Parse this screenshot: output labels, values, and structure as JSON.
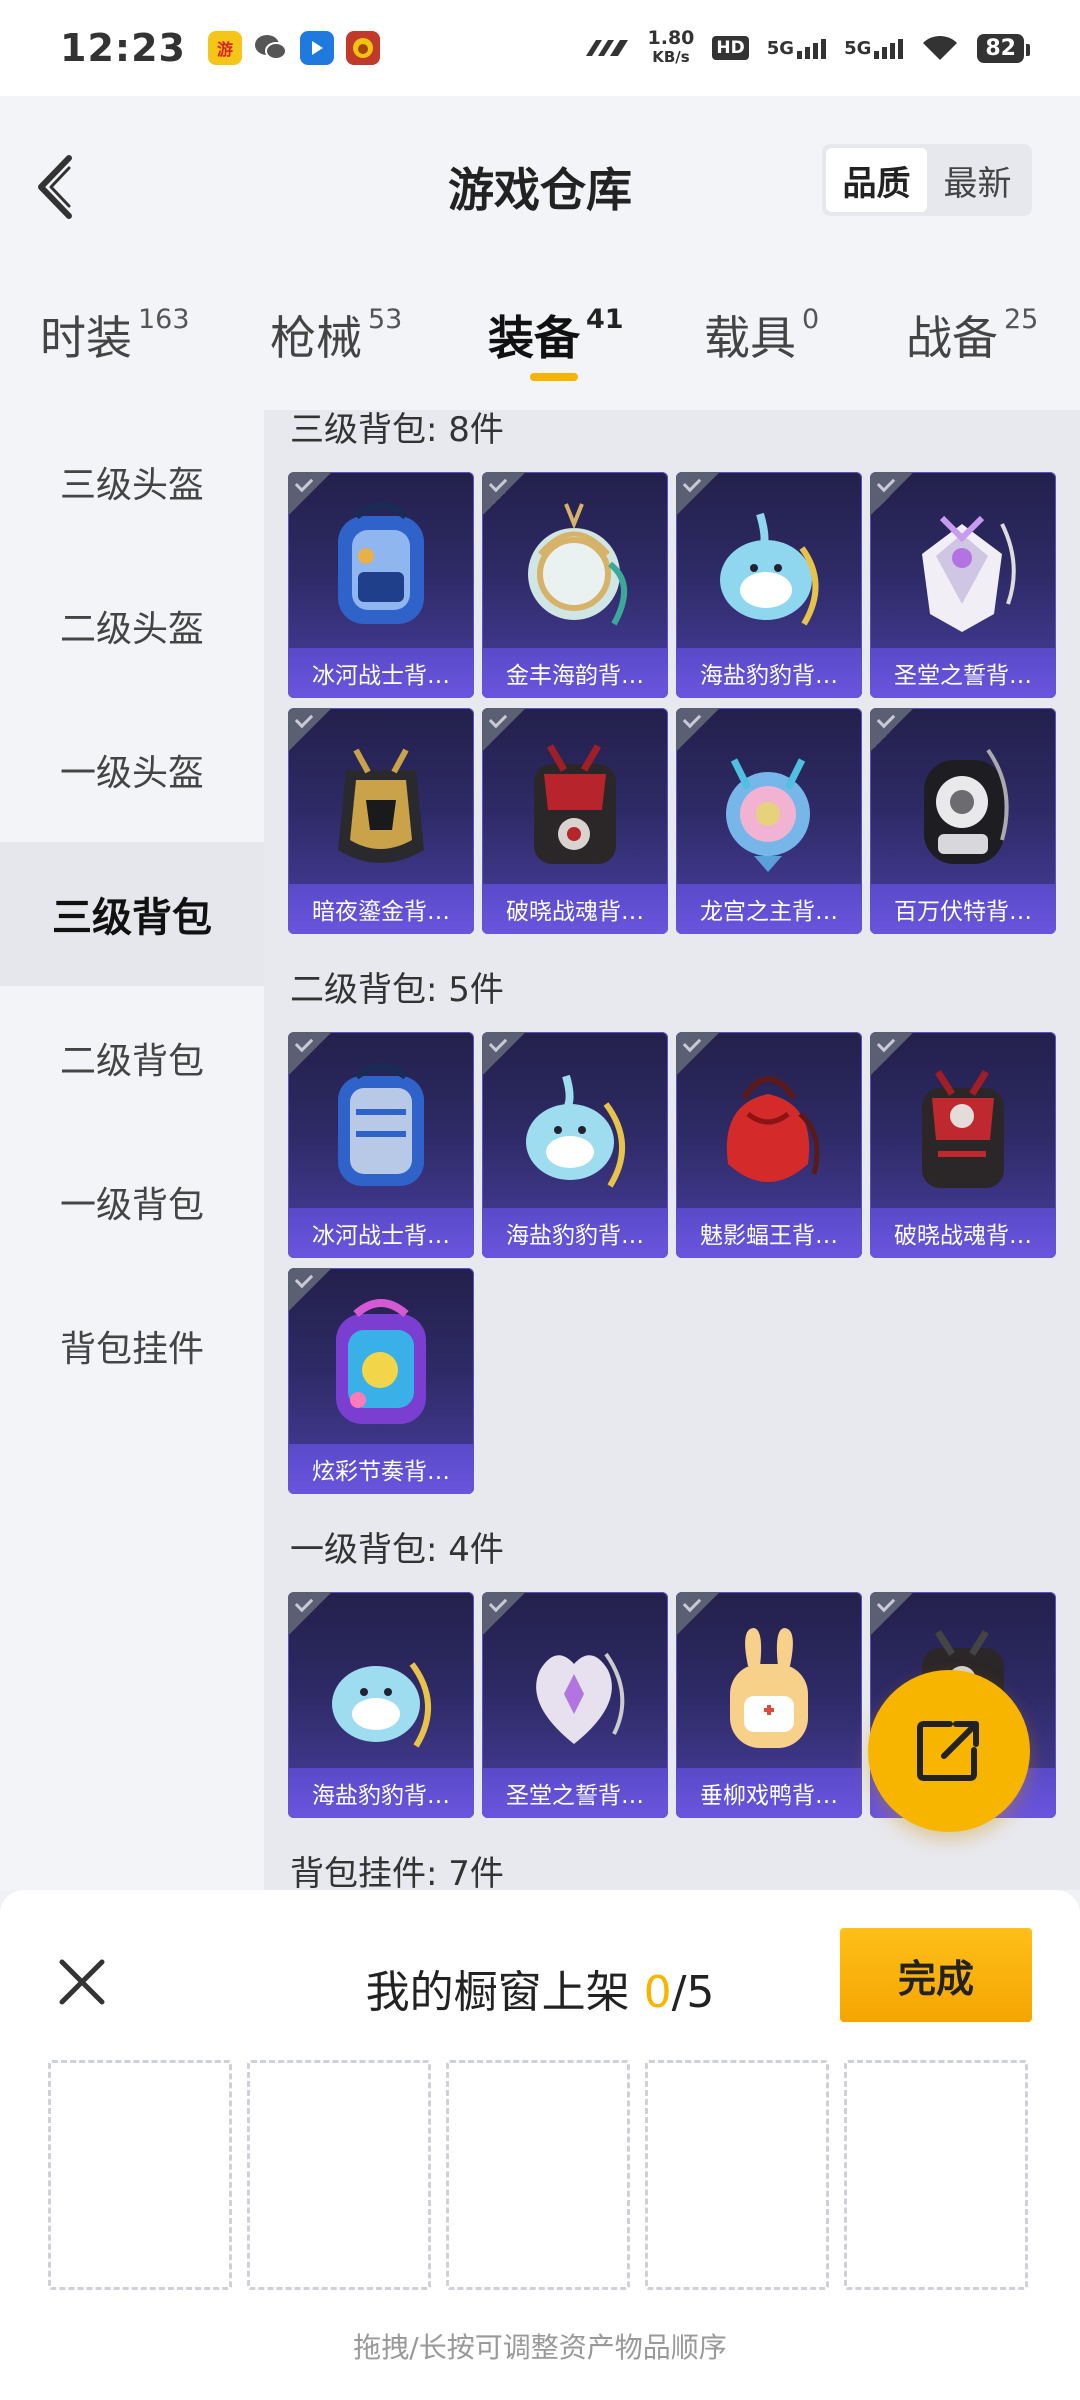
{
  "status_bar": {
    "time": "12:23",
    "net_speed_value": "1.80",
    "net_speed_unit": "KB/s",
    "hd_label": "HD",
    "sim1": "5G",
    "sim2": "5G",
    "battery": "82",
    "icons": [
      "game-app-icon",
      "wechat-icon",
      "blue-app-icon",
      "game-avatar-icon",
      "wifi-icon"
    ]
  },
  "header": {
    "title": "游戏仓库",
    "sort_options": [
      "品质",
      "最新"
    ],
    "active_sort": "品质"
  },
  "tabs": [
    {
      "label": "时装",
      "count": "163"
    },
    {
      "label": "枪械",
      "count": "53"
    },
    {
      "label": "装备",
      "count": "41"
    },
    {
      "label": "载具",
      "count": "0"
    },
    {
      "label": "战备",
      "count": "25"
    }
  ],
  "active_tab": "装备",
  "sidebar": {
    "items": [
      "三级头盔",
      "二级头盔",
      "一级头盔",
      "三级背包",
      "二级背包",
      "一级背包",
      "背包挂件"
    ],
    "active": "三级背包"
  },
  "sections": [
    {
      "title": "三级背包: 8件",
      "items": [
        "冰河战士背…",
        "金丰海韵背…",
        "海盐豹豹背…",
        "圣堂之誓背…",
        "暗夜鎏金背…",
        "破晓战魂背…",
        "龙宫之主背…",
        "百万伏特背…"
      ]
    },
    {
      "title": "二级背包: 5件",
      "items": [
        "冰河战士背…",
        "海盐豹豹背…",
        "魅影蝠王背…",
        "破晓战魂背…",
        "炫彩节奏背…"
      ]
    },
    {
      "title": "一级背包: 4件",
      "items": [
        "海盐豹豹背…",
        "圣堂之誓背…",
        "垂柳戏鸭背…",
        "…"
      ]
    },
    {
      "title": "背包挂件: 7件",
      "items": []
    }
  ],
  "share_fab": {
    "icon": "share-icon"
  },
  "bottom_sheet": {
    "title_prefix": "我的橱窗上架",
    "current": "0",
    "separator_total": "/5",
    "done_label": "完成",
    "slot_count": 5,
    "hint": "拖拽/长按可调整资产物品顺序"
  },
  "colors": {
    "accent": "#f7b500",
    "card_top": "#23204b",
    "card_label": "#6a55dd"
  }
}
